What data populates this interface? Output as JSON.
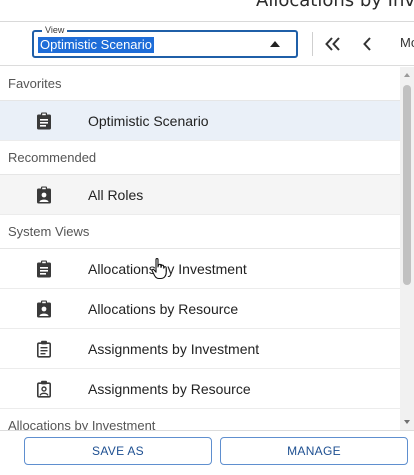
{
  "top_strip": {
    "clipped_heading": "Allocations by Investment"
  },
  "view_selector": {
    "legend": "View",
    "value": "Optimistic Scenario"
  },
  "nav": {
    "first_icon": "double-chevron-left-icon",
    "prev_icon": "chevron-left-icon",
    "more_label": "Mo"
  },
  "list": {
    "sections": [
      {
        "label": "Favorites",
        "items": [
          {
            "label": "Optimistic Scenario",
            "icon": "clipboard-list-filled-icon",
            "state": "selected"
          }
        ]
      },
      {
        "label": "Recommended",
        "items": [
          {
            "label": "All Roles",
            "icon": "clipboard-user-filled-icon",
            "state": "hover"
          }
        ]
      },
      {
        "label": "System Views",
        "items": [
          {
            "label": "Allocations by Investment",
            "icon": "clipboard-list-filled-icon",
            "state": ""
          },
          {
            "label": "Allocations by Resource",
            "icon": "clipboard-user-filled-icon",
            "state": ""
          },
          {
            "label": "Assignments by Investment",
            "icon": "clipboard-list-outline-icon",
            "state": ""
          },
          {
            "label": "Assignments by Resource",
            "icon": "clipboard-user-outline-icon",
            "state": ""
          }
        ]
      },
      {
        "label": "Allocations by Investment",
        "items": []
      }
    ]
  },
  "footer": {
    "save_as_label": "SAVE AS",
    "manage_label": "MANAGE"
  },
  "colors": {
    "accent": "#1e6dd8",
    "selected_row": "#eaf0f8",
    "button_text": "#1d4f91"
  }
}
